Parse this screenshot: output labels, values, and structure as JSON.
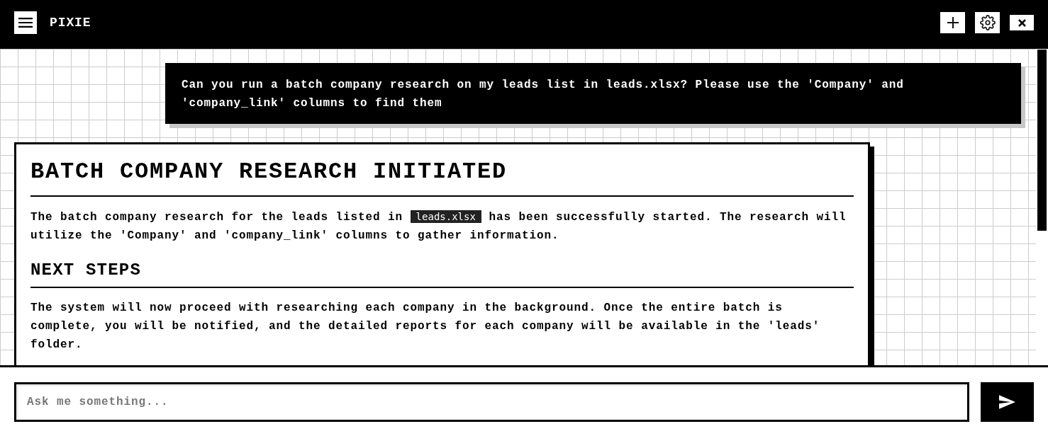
{
  "header": {
    "title": "PIXIE"
  },
  "messages": [
    {
      "kind": "user",
      "text": "Can you run a batch company research on my leads list in leads.xlsx? Please use the 'Company' and 'company_link' columns to find them"
    },
    {
      "kind": "assistant",
      "blocks": [
        {
          "kind": "heading1",
          "text": "BATCH COMPANY RESEARCH INITIATED"
        },
        {
          "kind": "paragraph",
          "parts": [
            {
              "kind": "text",
              "text": "The batch company research for the leads listed in"
            },
            {
              "kind": "code",
              "text": "leads.xlsx"
            },
            {
              "kind": "text",
              "text": "has been successfully started. The research will utilize the 'Company' and 'company_link' columns to gather information."
            }
          ]
        },
        {
          "kind": "heading2",
          "text": "NEXT STEPS"
        },
        {
          "kind": "paragraph",
          "parts": [
            {
              "kind": "text",
              "text": "The system will now proceed with researching each company in the background. Once the entire batch is complete, you will be notified, and the detailed reports for each company will be available in the 'leads' folder."
            }
          ]
        }
      ]
    }
  ],
  "composer": {
    "placeholder": "Ask me something..."
  }
}
